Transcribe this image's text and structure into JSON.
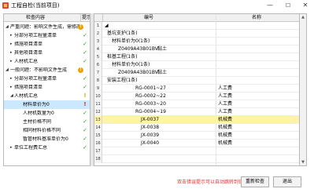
{
  "window": {
    "title": "工程自检(当前项目)",
    "controls": {
      "minimize": "—",
      "maximize": "☐",
      "close": "✕"
    }
  },
  "left": {
    "headers": {
      "content": "检查内容",
      "hint": "提示"
    },
    "items": [
      {
        "toggle": "◢",
        "label": "严重问题：影响文件生成，需修改",
        "status": "!"
      },
      {
        "toggle": "▸",
        "label": "分部分项工程量清单",
        "status": "✓"
      },
      {
        "toggle": "▸",
        "label": "措施项目清单",
        "status": "✓"
      },
      {
        "toggle": "▸",
        "label": "其他项目清单",
        "status": "✓"
      },
      {
        "toggle": "▸",
        "label": "人材机汇总",
        "status": "✓"
      },
      {
        "toggle": "◢",
        "label": "一般问题：不影响文件生成",
        "status": "!"
      },
      {
        "toggle": "▸",
        "label": "分部分项工程量清单",
        "status": "✓"
      },
      {
        "toggle": "▸",
        "label": "措施项目清单",
        "status": "✓"
      },
      {
        "toggle": "◢",
        "label": "人材机汇总",
        "status": "!"
      },
      {
        "toggle": "",
        "label": "材料单价为0",
        "status": "!"
      },
      {
        "toggle": "",
        "label": "人材机数量为0",
        "status": "✓"
      },
      {
        "toggle": "",
        "label": "主材价格不同",
        "status": "✓"
      },
      {
        "toggle": "",
        "label": "相同材料价格不同",
        "status": "✓"
      },
      {
        "toggle": "",
        "label": "暂管材料基准单价为0",
        "status": "✓"
      },
      {
        "toggle": "▸",
        "label": "单位工程费汇总",
        "status": "✓"
      }
    ]
  },
  "grid": {
    "headers": {
      "code": "编号",
      "name": "名称"
    },
    "rows": [
      {
        "num": "1",
        "code": "◢",
        "name": ""
      },
      {
        "num": "2",
        "code": "基坑支护(1条)",
        "name": ""
      },
      {
        "num": "3",
        "code": "材料单价为0(1条)",
        "name": ""
      },
      {
        "num": "4",
        "code": "Z0409A43B01BV",
        "name": "黏土"
      },
      {
        "num": "5",
        "code": "桩基工程(1条)",
        "name": ""
      },
      {
        "num": "6",
        "code": "材料单价为0(1条)",
        "name": ""
      },
      {
        "num": "7",
        "code": "Z0409A43B01BV",
        "name": "黏土"
      },
      {
        "num": "8",
        "code": "安装工程(1条)",
        "name": ""
      },
      {
        "num": "9",
        "code": "RG-0001~27",
        "name": "人工费"
      },
      {
        "num": "10",
        "code": "RG-0002~22",
        "name": "人工费"
      },
      {
        "num": "11",
        "code": "RG-0003~20",
        "name": "人工费"
      },
      {
        "num": "12",
        "code": "RG-0004~19",
        "name": "人工费"
      },
      {
        "num": "13",
        "code": "JX-0037",
        "name": "机械费"
      },
      {
        "num": "14",
        "code": "JX-0038",
        "name": "机械费"
      },
      {
        "num": "15",
        "code": "JX-0039",
        "name": "机械费"
      },
      {
        "num": "16",
        "code": "JX-0040",
        "name": "机械费"
      },
      {
        "num": "17",
        "code": "",
        "name": ""
      },
      {
        "num": "18",
        "code": "",
        "name": ""
      }
    ]
  },
  "footer": {
    "message": "双击错误提示可以自动跳转到错误行",
    "recheck_label": "重新检查",
    "exit_label": "退出"
  },
  "scrollbar": {
    "up": "▲",
    "down": "▼"
  },
  "colors": {
    "highlight_row": "#fff3a8",
    "selected_item": "#cce8ff",
    "ok": "#1aa31a",
    "warn": "#e0a000",
    "error": "#e02020",
    "footer_message": "#e03030"
  }
}
